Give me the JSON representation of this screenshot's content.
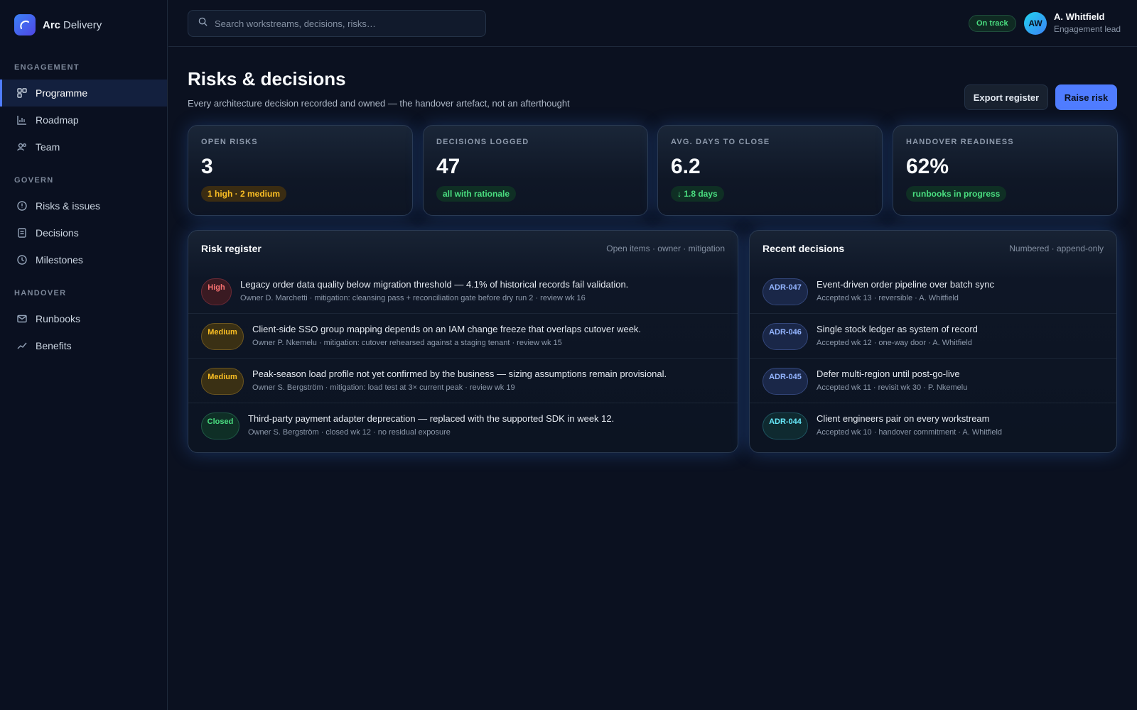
{
  "brand": {
    "name": "Arc",
    "sub": "Delivery"
  },
  "sidebar": {
    "sections": [
      {
        "title": "ENGAGEMENT",
        "items": [
          {
            "label": "Programme",
            "icon": "grid-icon",
            "active": true
          },
          {
            "label": "Roadmap",
            "icon": "bar-chart-icon"
          },
          {
            "label": "Team",
            "icon": "users-icon"
          }
        ]
      },
      {
        "title": "GOVERN",
        "items": [
          {
            "label": "Risks & issues",
            "icon": "alert-circle-icon"
          },
          {
            "label": "Decisions",
            "icon": "document-icon"
          },
          {
            "label": "Milestones",
            "icon": "clock-icon"
          }
        ]
      },
      {
        "title": "HANDOVER",
        "items": [
          {
            "label": "Runbooks",
            "icon": "mail-icon"
          },
          {
            "label": "Benefits",
            "icon": "trend-icon"
          }
        ]
      }
    ]
  },
  "header": {
    "search_placeholder": "Search workstreams, decisions, risks…",
    "status": "On track",
    "user": {
      "initials": "AW",
      "name": "A. Whitfield",
      "role": "Engagement lead"
    }
  },
  "page": {
    "title": "Risks & decisions",
    "subtitle": "Every architecture decision recorded and owned — the handover artefact, not an afterthought",
    "export_label": "Export register",
    "raise_label": "Raise risk"
  },
  "stats": [
    {
      "label": "OPEN RISKS",
      "value": "3",
      "badge": "1 high · 2 medium",
      "tone": "amber"
    },
    {
      "label": "DECISIONS LOGGED",
      "value": "47",
      "badge": "all with rationale",
      "tone": "green"
    },
    {
      "label": "AVG. DAYS TO CLOSE",
      "value": "6.2",
      "badge": "↓ 1.8 days",
      "tone": "green"
    },
    {
      "label": "HANDOVER READINESS",
      "value": "62%",
      "badge": "runbooks in progress",
      "tone": "green"
    }
  ],
  "risk_register": {
    "title": "Risk register",
    "meta": "Open items · owner · mitigation",
    "rows": [
      {
        "severity": "High",
        "kind": "high",
        "title": "Legacy order data quality below migration threshold — 4.1% of historical records fail validation.",
        "sub": "Owner D. Marchetti · mitigation: cleansing pass + reconciliation gate before dry run 2 · review wk 16"
      },
      {
        "severity": "Medium",
        "kind": "medium",
        "title": "Client-side SSO group mapping depends on an IAM change freeze that overlaps cutover week.",
        "sub": "Owner P. Nkemelu · mitigation: cutover rehearsed against a staging tenant · review wk 15"
      },
      {
        "severity": "Medium",
        "kind": "medium",
        "title": "Peak-season load profile not yet confirmed by the business — sizing assumptions remain provisional.",
        "sub": "Owner S. Bergström · mitigation: load test at 3× current peak · review wk 19"
      },
      {
        "severity": "Closed",
        "kind": "closed",
        "title": "Third-party payment adapter deprecation — replaced with the supported SDK in week 12.",
        "sub": "Owner S. Bergström · closed wk 12 · no residual exposure"
      }
    ]
  },
  "decisions": {
    "title": "Recent decisions",
    "meta": "Numbered · append-only",
    "rows": [
      {
        "id": "ADR-047",
        "kind": "adr",
        "title": "Event-driven order pipeline over batch sync",
        "sub": "Accepted wk 13 · reversible · A. Whitfield"
      },
      {
        "id": "ADR-046",
        "kind": "adr",
        "title": "Single stock ledger as system of record",
        "sub": "Accepted wk 12 · one-way door · A. Whitfield"
      },
      {
        "id": "ADR-045",
        "kind": "adr",
        "title": "Defer multi-region until post-go-live",
        "sub": "Accepted wk 11 · revisit wk 30 · P. Nkemelu"
      },
      {
        "id": "ADR-044",
        "kind": "adr-teal",
        "title": "Client engineers pair on every workstream",
        "sub": "Accepted wk 10 · handover commitment · A. Whitfield"
      }
    ]
  }
}
